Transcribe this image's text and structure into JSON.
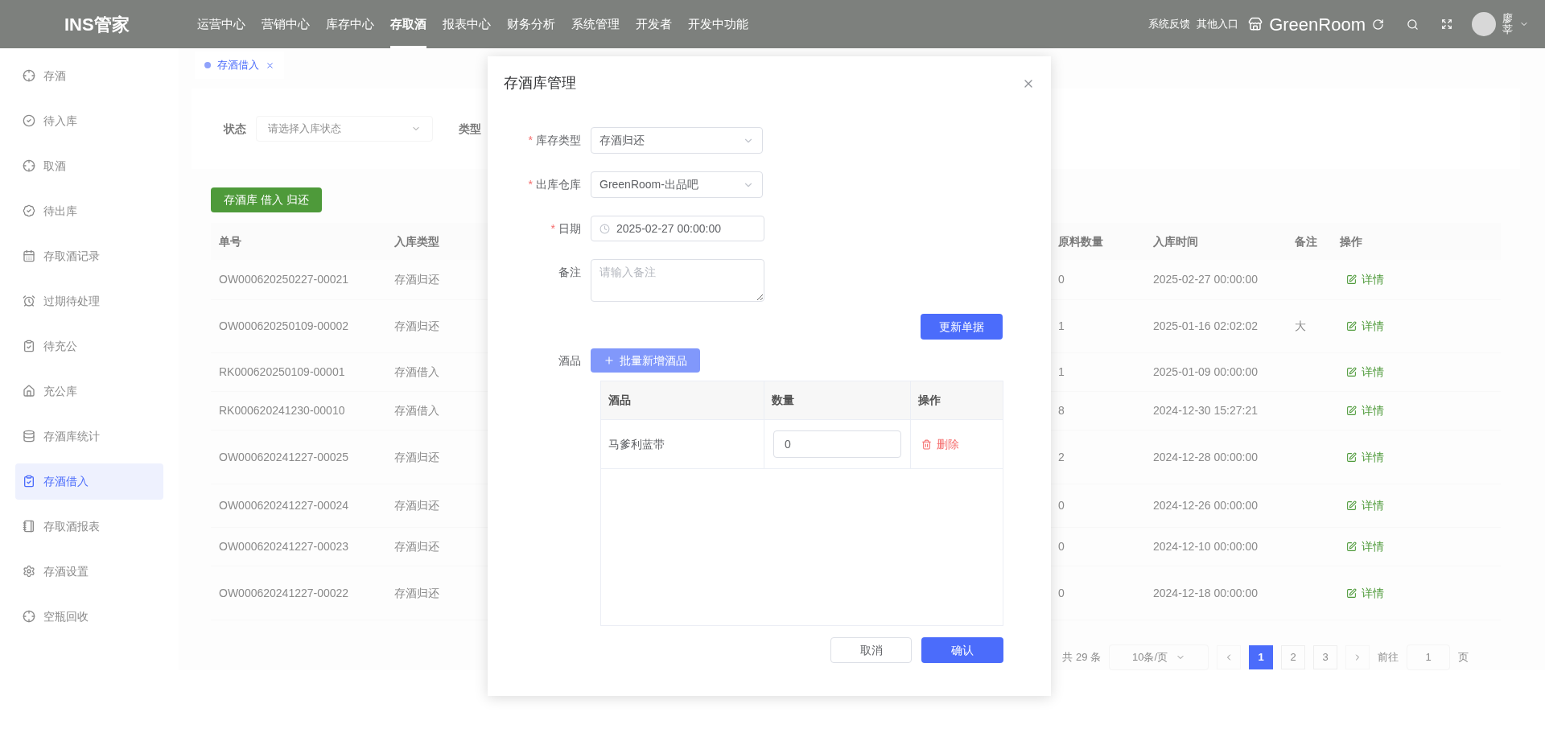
{
  "header": {
    "logo": "INS管家",
    "nav": [
      {
        "label": "运营中心",
        "selected": false
      },
      {
        "label": "营销中心",
        "selected": false
      },
      {
        "label": "库存中心",
        "selected": false
      },
      {
        "label": "存取酒",
        "selected": true
      },
      {
        "label": "报表中心",
        "selected": false
      },
      {
        "label": "财务分析",
        "selected": false
      },
      {
        "label": "系统管理",
        "selected": false
      },
      {
        "label": "开发者",
        "selected": false
      },
      {
        "label": "开发中功能",
        "selected": false
      }
    ],
    "links": [
      "系统反馈",
      "其他入口"
    ],
    "store": "GreenRoom",
    "user": "廖莘"
  },
  "sidebar": {
    "items": [
      {
        "label": "存酒",
        "selected": false
      },
      {
        "label": "待入库",
        "selected": false
      },
      {
        "label": "取酒",
        "selected": false
      },
      {
        "label": "待出库",
        "selected": false
      },
      {
        "label": "存取酒记录",
        "selected": false
      },
      {
        "label": "过期待处理",
        "selected": false
      },
      {
        "label": "待充公",
        "selected": false
      },
      {
        "label": "充公库",
        "selected": false
      },
      {
        "label": "存酒库统计",
        "selected": false
      },
      {
        "label": "存酒借入",
        "selected": true
      },
      {
        "label": "存取酒报表",
        "selected": false
      },
      {
        "label": "存酒设置",
        "selected": false
      },
      {
        "label": "空瓶回收",
        "selected": false
      }
    ]
  },
  "tabs": [
    {
      "label": "存酒借入",
      "selected": true
    }
  ],
  "filters": [
    {
      "label": "状态",
      "placeholder": "请选择入库状态"
    },
    {
      "label": "类型"
    }
  ],
  "action_button": "存酒库 借入 归还",
  "table": {
    "columns": [
      "单号",
      "入库类型",
      "原料数量",
      "入库时间",
      "备注",
      "操作"
    ],
    "rows": [
      {
        "number": "OW000620250227-00021",
        "type": "存酒归还",
        "quantity": "0",
        "time": "2025-02-27 00:00:00",
        "note": "",
        "action": "详情"
      },
      {
        "number": "OW000620250109-00002",
        "type": "存酒归还",
        "quantity": "1",
        "time": "2025-01-16 02:02:02",
        "note": "大",
        "action": "详情"
      },
      {
        "number": "RK000620250109-00001",
        "type": "存酒借入",
        "quantity": "1",
        "time": "2025-01-09 00:00:00",
        "note": "",
        "action": "详情"
      },
      {
        "number": "RK000620241230-00010",
        "type": "存酒借入",
        "quantity": "8",
        "time": "2024-12-30 15:27:21",
        "note": "",
        "action": "详情"
      },
      {
        "number": "OW000620241227-00025",
        "type": "存酒归还",
        "quantity": "2",
        "time": "2024-12-28 00:00:00",
        "note": "",
        "action": "详情"
      },
      {
        "number": "OW000620241227-00024",
        "type": "存酒归还",
        "quantity": "0",
        "time": "2024-12-26 00:00:00",
        "note": "",
        "action": "详情"
      },
      {
        "number": "OW000620241227-00023",
        "type": "存酒归还",
        "quantity": "0",
        "time": "2024-12-10 00:00:00",
        "note": "",
        "action": "详情"
      },
      {
        "number": "OW000620241227-00022",
        "type": "存酒归还",
        "quantity": "0",
        "time": "2024-12-18 00:00:00",
        "note": "",
        "action": "详情"
      }
    ]
  },
  "pagination": {
    "total": "共 29 条",
    "page_size": "10条/页",
    "pages": [
      {
        "label": "1",
        "selected": true
      },
      {
        "label": "2",
        "selected": false
      },
      {
        "label": "3",
        "selected": false
      }
    ],
    "goto_label": "前往",
    "goto_value": "1",
    "page_suffix": "页"
  },
  "dialog": {
    "title": "存酒库管理",
    "fields": [
      {
        "label": "库存类型",
        "required": true,
        "kind": "select",
        "value": "存酒归还"
      },
      {
        "label": "出库仓库",
        "required": true,
        "kind": "select",
        "value": "GreenRoom-出品吧"
      },
      {
        "label": "日期",
        "required": true,
        "kind": "date",
        "value": "2025-02-27 00:00:00"
      },
      {
        "label": "备注",
        "required": false,
        "kind": "textarea",
        "placeholder": "请输入备注"
      }
    ],
    "required_mark": "*",
    "update_button": "更新单据",
    "items_label": "酒品",
    "add_button": "批量新增酒品",
    "columns": [
      "酒品",
      "数量",
      "操作"
    ],
    "rows": [
      {
        "name": "马爹利蓝带",
        "quantity": "0",
        "action": "删除"
      }
    ],
    "cancel": "取消",
    "confirm": "确认"
  }
}
